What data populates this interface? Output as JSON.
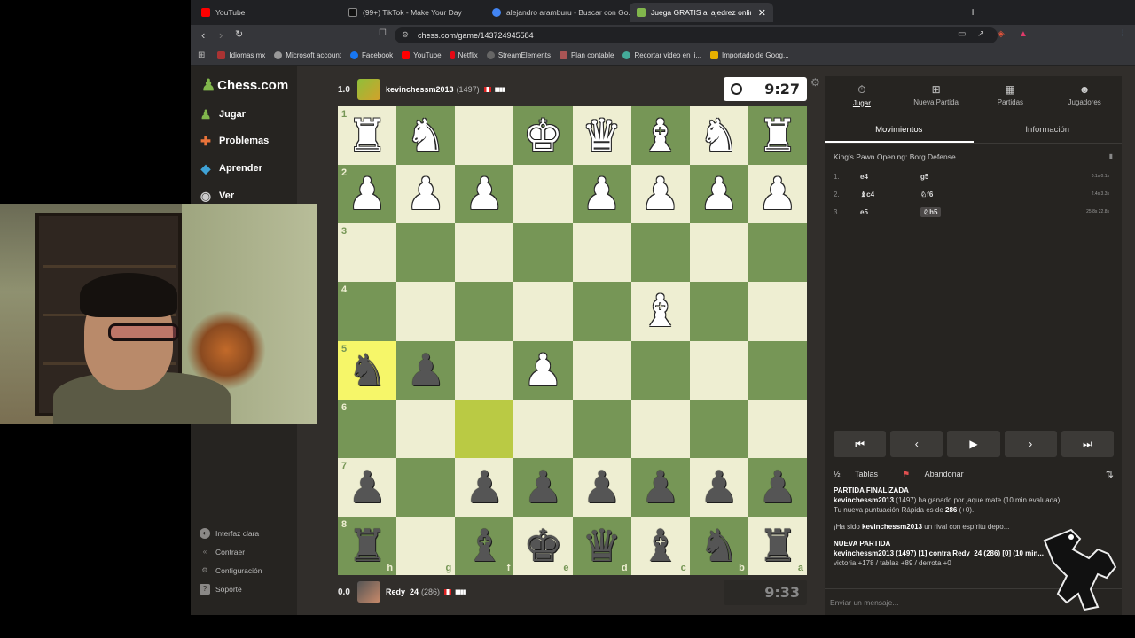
{
  "browser": {
    "tabs": [
      {
        "title": "YouTube",
        "color": "#ff0000"
      },
      {
        "title": "(99+) TikTok - Make Your Day",
        "color": "#111111"
      },
      {
        "title": "alejandro aramburu - Buscar con Go...",
        "color": "#4285f4"
      },
      {
        "title": "Juega GRATIS al ajedrez online - ",
        "color": "#81b64c",
        "active": true
      }
    ],
    "url": "chess.com/game/143724945584",
    "bookmarks": [
      {
        "label": "Idiomas mx",
        "color": "#a33"
      },
      {
        "label": "Microsoft account",
        "color": "#999"
      },
      {
        "label": "Facebook",
        "color": "#1877f2"
      },
      {
        "label": "YouTube",
        "color": "#ff0000"
      },
      {
        "label": "Netflix",
        "color": "#e50914"
      },
      {
        "label": "StreamElements",
        "color": "#666"
      },
      {
        "label": "Plan contable",
        "color": "#a55"
      },
      {
        "label": "Recortar video en li...",
        "color": "#4a9"
      },
      {
        "label": "Importado de Goog...",
        "color": "#e6b000"
      }
    ]
  },
  "sidebar": {
    "logo": "Chess.com",
    "items": [
      {
        "label": "Jugar",
        "icon": "play-icon",
        "color": "#81b64c"
      },
      {
        "label": "Problemas",
        "icon": "puzzle-icon",
        "color": "#e8733a"
      },
      {
        "label": "Aprender",
        "icon": "learn-icon",
        "color": "#3fa2d6"
      },
      {
        "label": "Ver",
        "icon": "watch-icon",
        "color": "#ccc"
      }
    ],
    "footer": [
      {
        "label": "Interfaz clara",
        "icon": "theme-icon"
      },
      {
        "label": "Contraer",
        "icon": "collapse-icon"
      },
      {
        "label": "Configuración",
        "icon": "gear-icon"
      },
      {
        "label": "Soporte",
        "icon": "help-icon"
      }
    ]
  },
  "top_player": {
    "score": "1.0",
    "name": "kevinchessm2013",
    "rating": "(1497)",
    "clock": "9:27"
  },
  "bottom_player": {
    "score": "0.0",
    "name": "Redy_24",
    "rating": "(286)",
    "clock": "9:33"
  },
  "board": {
    "rows": [
      {
        "rank": "1",
        "cells": [
          "wR",
          "wN",
          "",
          "wK",
          "wQ",
          "wB",
          "wN",
          "wR"
        ]
      },
      {
        "rank": "2",
        "cells": [
          "wP",
          "wP",
          "wP",
          "",
          "wP",
          "wP",
          "wP",
          "wP"
        ]
      },
      {
        "rank": "3",
        "cells": [
          "",
          "",
          "",
          "",
          "",
          "",
          "",
          ""
        ]
      },
      {
        "rank": "4",
        "cells": [
          "",
          "",
          "",
          "",
          "",
          "wB",
          "",
          ""
        ]
      },
      {
        "rank": "5",
        "cells": [
          "bN",
          "bP",
          "",
          "wP",
          "",
          "",
          "",
          ""
        ]
      },
      {
        "rank": "6",
        "cells": [
          "",
          "",
          "",
          "",
          "",
          "",
          "",
          ""
        ]
      },
      {
        "rank": "7",
        "cells": [
          "bP",
          "",
          "bP",
          "bP",
          "bP",
          "bP",
          "bP",
          "bP"
        ]
      },
      {
        "rank": "8",
        "cells": [
          "bR",
          "",
          "bB",
          "bK",
          "bQ",
          "bB",
          "bN",
          "bR"
        ]
      }
    ],
    "files": [
      "h",
      "g",
      "f",
      "e",
      "d",
      "c",
      "b",
      "a"
    ],
    "highlight_from": [
      4,
      0
    ],
    "highlight_to": [
      5,
      2
    ]
  },
  "right_panel": {
    "tabs": [
      {
        "label": "Jugar",
        "icon": "clock-icon",
        "active": true
      },
      {
        "label": "Nueva Partida",
        "icon": "plus-icon"
      },
      {
        "label": "Partidas",
        "icon": "board-icon"
      },
      {
        "label": "Jugadores",
        "icon": "players-icon"
      }
    ],
    "subtabs": [
      {
        "label": "Movimientos",
        "active": true
      },
      {
        "label": "Información"
      }
    ],
    "opening": "King's Pawn Opening: Borg Defense",
    "moves": [
      {
        "num": "1.",
        "white": "e4",
        "black": "g5",
        "times": "0.1s 0.1s"
      },
      {
        "num": "2.",
        "white": "♝c4",
        "black": "♘f6",
        "times": "2.4s 3.3s"
      },
      {
        "num": "3.",
        "white": "e5",
        "black": "♘h5",
        "times": "25.8s 22.8s"
      }
    ],
    "controls": [
      "first-move-icon",
      "prev-move-icon",
      "play-icon",
      "next-move-icon",
      "last-move-icon"
    ],
    "actions": {
      "draw": "Tablas",
      "resign": "Abandonar"
    },
    "chat": {
      "finished_title": "PARTIDA FINALIZADA",
      "result_user": "kevinchessm2013",
      "result_text": " (1497) ha ganado por jaque mate (10 min evaluada)",
      "rating_text": "Tu nueva puntuación Rápida es de ",
      "rating_value": "286",
      "rating_change": " (+0).",
      "sport_pre": "¡Ha sido ",
      "sport_user": "kevinchessm2013",
      "sport_post": " un rival con espíritu depo...",
      "new_title": "NUEVA PARTIDA",
      "new_text": "kevinchessm2013 (1497) [1] contra Redy_24 (286) [0] (10 min...",
      "new_stats": "victoria +178 / tablas +89 / derrota +0"
    },
    "message_placeholder": "Enviar un mensaje..."
  }
}
